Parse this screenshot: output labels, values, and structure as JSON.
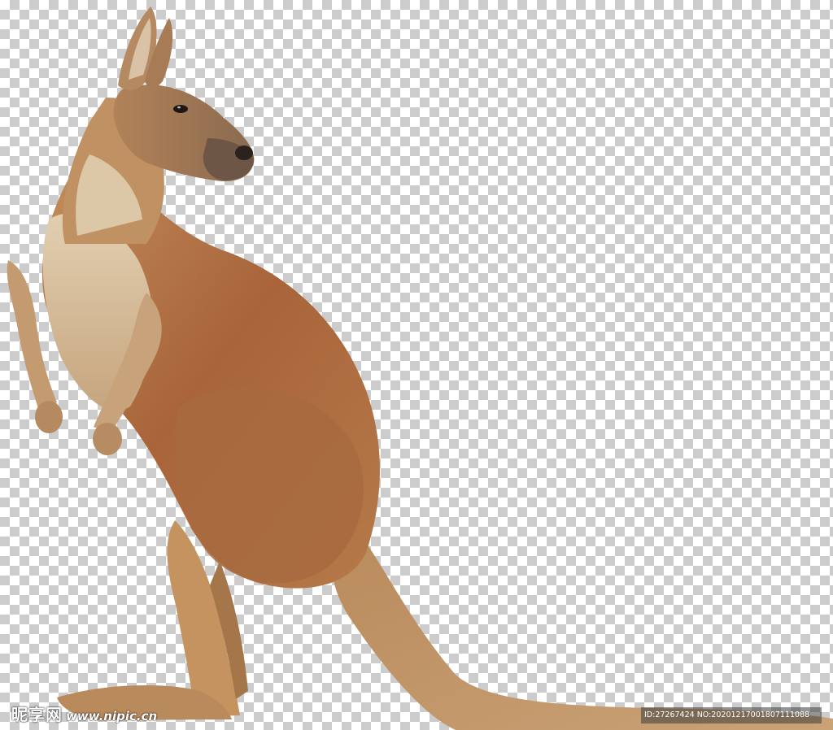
{
  "image": {
    "subject": "kangaroo",
    "background": "transparent-checkerboard",
    "colors": {
      "fur_main": "#b9854f",
      "fur_back": "#a9643a",
      "fur_light": "#d8c3a2",
      "fur_dark": "#7b4a2a",
      "check_light": "#ffffff",
      "check_dark": "#cccccc"
    }
  },
  "watermark": {
    "logo": "昵享网",
    "url": "www.nipic.cn",
    "id_text": "ID:27267424 NO:20201217001807111088"
  }
}
